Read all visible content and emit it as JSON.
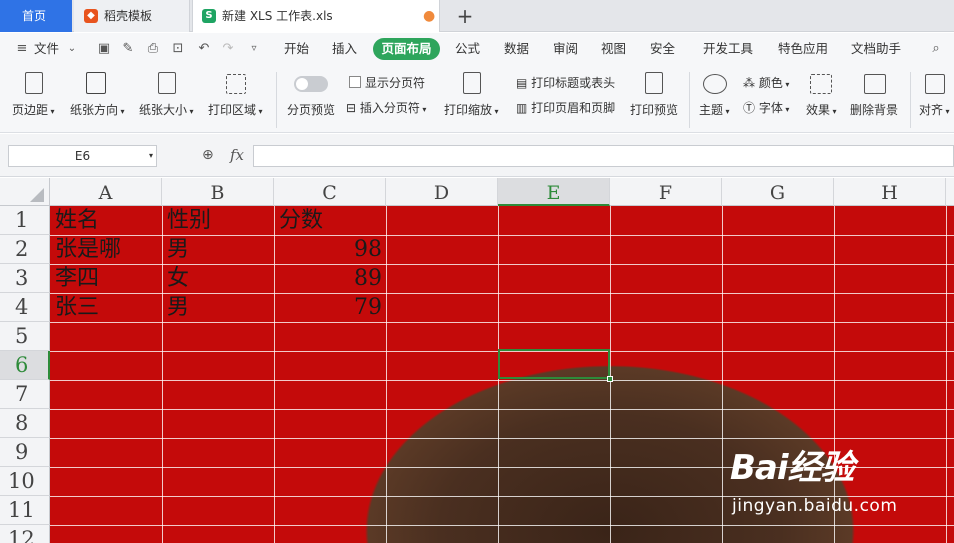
{
  "tabs": {
    "home": "首页",
    "template": "稻壳模板",
    "document": "新建 XLS 工作表.xls",
    "add": "+"
  },
  "menu": {
    "file": "文件",
    "items": [
      "开始",
      "插入",
      "页面布局",
      "公式",
      "数据",
      "审阅",
      "视图",
      "安全",
      "开发工具",
      "特色应用",
      "文档助手"
    ],
    "active": "页面布局"
  },
  "ribbon": {
    "margins": "页边距",
    "orientation": "纸张方向",
    "size": "纸张大小",
    "print_area": "打印区域",
    "page_break_preview": "分页预览",
    "show_page_breaks": "显示分页符",
    "insert_page_break": "插入分页符",
    "print_scaling": "打印缩放",
    "print_titles": "打印标题或表头",
    "header_footer": "打印页眉和页脚",
    "print_preview": "打印预览",
    "theme": "主题",
    "colors": "颜色",
    "fonts": "字体",
    "effects": "效果",
    "remove_background": "删除背景",
    "align": "对齐"
  },
  "formula_bar": {
    "name_box": "E6",
    "fx": "fx",
    "value": ""
  },
  "columns": [
    "A",
    "B",
    "C",
    "D",
    "E",
    "F",
    "G",
    "H"
  ],
  "rows": [
    "1",
    "2",
    "3",
    "4",
    "5",
    "6",
    "7",
    "8",
    "9",
    "10",
    "11",
    "12"
  ],
  "cells": {
    "A1": "姓名",
    "B1": "性别",
    "C1": "分数",
    "A2": "张是哪",
    "B2": "男",
    "C2": "98",
    "A3": "李四",
    "B3": "女",
    "C3": "89",
    "A4": "张三",
    "B4": "男",
    "C4": "79"
  },
  "selection": "E6",
  "colors": {
    "accent_blue": "#2f73e6",
    "active_tab_green": "#2ea55c",
    "sheet_background_red": "#c40a0a",
    "selection_green": "#2e8b3a"
  },
  "watermark": {
    "logo": "Bai经验",
    "url": "jingyan.baidu.com"
  }
}
